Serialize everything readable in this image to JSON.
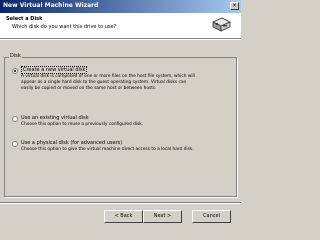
{
  "window": {
    "title": "New Virtual Machine Wizard",
    "close_glyph": "×"
  },
  "header": {
    "title": "Select a Disk",
    "subtitle": "Which disk do you want this drive to use?",
    "icon": "disk-drive-icon"
  },
  "group": {
    "label": "Disk"
  },
  "options": [
    {
      "label": "Create a new virtual disk",
      "selected": true,
      "description": [
        "A virtual disk is composed of one or more files on the host file system, which will",
        "appear as a single hard disk to the guest operating system. Virtual disks can",
        "easily be copied or moved on the same host or between hosts."
      ]
    },
    {
      "label": "Use an existing virtual disk",
      "selected": false,
      "description": [
        "Choose this option to reuse a previously configured disk."
      ]
    },
    {
      "label": "Use a physical disk (for advanced users)",
      "selected": false,
      "description": [
        "Choose this option to give the virtual machine direct access to a local hard disk."
      ]
    }
  ],
  "buttons": {
    "back": "< Back",
    "next": "Next >",
    "cancel": "Cancel"
  }
}
